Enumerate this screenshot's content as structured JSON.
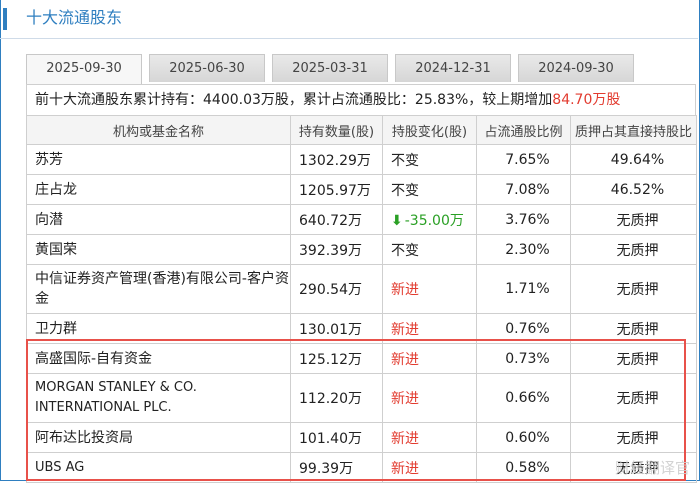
{
  "header": {
    "title": "十大流通股东"
  },
  "tabs": [
    {
      "label": "2025-09-30",
      "active": true
    },
    {
      "label": "2025-06-30",
      "active": false
    },
    {
      "label": "2025-03-31",
      "active": false
    },
    {
      "label": "2024-12-31",
      "active": false
    },
    {
      "label": "2024-09-30",
      "active": false
    }
  ],
  "summary": {
    "prefix": "前十大流通股东累计持有：",
    "total_held": "4400.03万股",
    "ratio_label": "，累计占流通股比：",
    "ratio": "25.83%",
    "compare_label": "，较上期增加",
    "increase": "84.70万股"
  },
  "table": {
    "columns": [
      "机构或基金名称",
      "持有数量(股)",
      "持股变化(股)",
      "占流通股比例",
      "质押占其直接持股比"
    ],
    "rows": [
      {
        "name": "苏芳",
        "qty": "1302.29万",
        "change": "不变",
        "change_type": "same",
        "ratio": "7.65%",
        "pledge": "49.64%"
      },
      {
        "name": "庄占龙",
        "qty": "1205.97万",
        "change": "不变",
        "change_type": "same",
        "ratio": "7.08%",
        "pledge": "46.52%"
      },
      {
        "name": "向潜",
        "qty": "640.72万",
        "change": "-35.00万",
        "change_type": "decrease",
        "ratio": "3.76%",
        "pledge": "无质押"
      },
      {
        "name": "黄国荣",
        "qty": "392.39万",
        "change": "不变",
        "change_type": "same",
        "ratio": "2.30%",
        "pledge": "无质押"
      },
      {
        "name": "中信证券资产管理(香港)有限公司-客户资金",
        "qty": "290.54万",
        "change": "新进",
        "change_type": "new",
        "ratio": "1.71%",
        "pledge": "无质押"
      },
      {
        "name": "卫力群",
        "qty": "130.01万",
        "change": "新进",
        "change_type": "new",
        "ratio": "0.76%",
        "pledge": "无质押"
      },
      {
        "name": "高盛国际-自有资金",
        "qty": "125.12万",
        "change": "新进",
        "change_type": "new",
        "ratio": "0.73%",
        "pledge": "无质押"
      },
      {
        "name": "MORGAN STANLEY & CO. INTERNATIONAL PLC.",
        "qty": "112.20万",
        "change": "新进",
        "change_type": "new",
        "ratio": "0.66%",
        "pledge": "无质押"
      },
      {
        "name": "阿布达比投资局",
        "qty": "101.40万",
        "change": "新进",
        "change_type": "new",
        "ratio": "0.60%",
        "pledge": "无质押"
      },
      {
        "name": "UBS AG",
        "qty": "99.39万",
        "change": "新进",
        "change_type": "new",
        "ratio": "0.58%",
        "pledge": "无质押"
      }
    ]
  },
  "watermark": "财经翻译官",
  "colors": {
    "accent": "#2f7fc0",
    "red": "#e23b2f",
    "green": "#2aa025",
    "highlight": "#e8514a"
  }
}
